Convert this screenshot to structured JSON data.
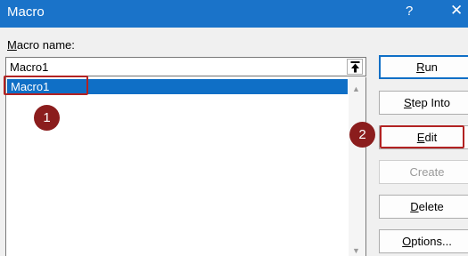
{
  "window": {
    "title": "Macro",
    "help_glyph": "?",
    "close_glyph": "✕"
  },
  "macro_name": {
    "label_key": "M",
    "label_rest": "acro name:",
    "value": "Macro1"
  },
  "macro_list": {
    "items": [
      "Macro1"
    ]
  },
  "buttons": [
    {
      "key": "R",
      "rest": "un",
      "state": "default"
    },
    {
      "key": "S",
      "rest": "tep Into",
      "state": "normal"
    },
    {
      "key": "E",
      "rest": "dit",
      "state": "normal"
    },
    {
      "key": "",
      "rest": "Create",
      "state": "disabled"
    },
    {
      "key": "D",
      "rest": "elete",
      "state": "normal"
    },
    {
      "key": "O",
      "rest": "ptions...",
      "state": "normal"
    }
  ],
  "callouts": [
    "1",
    "2"
  ],
  "colors": {
    "titlebar": "#1a73c9",
    "selection": "#0f6fc6",
    "callout": "#8b1d1d",
    "highlight_border": "#b22222"
  }
}
